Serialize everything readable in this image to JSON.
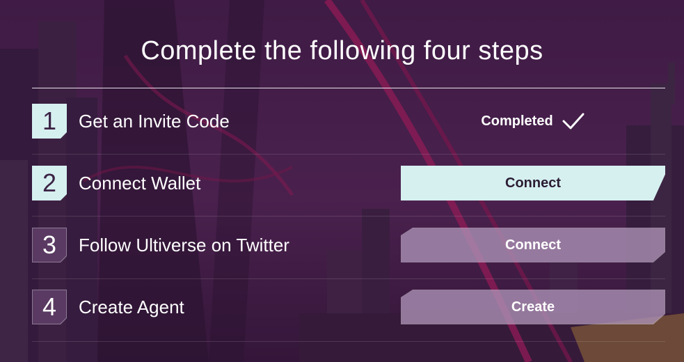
{
  "title": "Complete the following four steps",
  "steps": [
    {
      "number": "1",
      "label": "Get an Invite Code",
      "status": "Completed",
      "status_icon": "checkmark-icon"
    },
    {
      "number": "2",
      "label": "Connect Wallet",
      "action": "Connect"
    },
    {
      "number": "3",
      "label": "Follow Ultiverse on Twitter",
      "action": "Connect"
    },
    {
      "number": "4",
      "label": "Create Agent",
      "action": "Create"
    }
  ],
  "colors": {
    "accent": "#d6f0f0",
    "background": "#3e1d45",
    "text": "#ffffff"
  }
}
